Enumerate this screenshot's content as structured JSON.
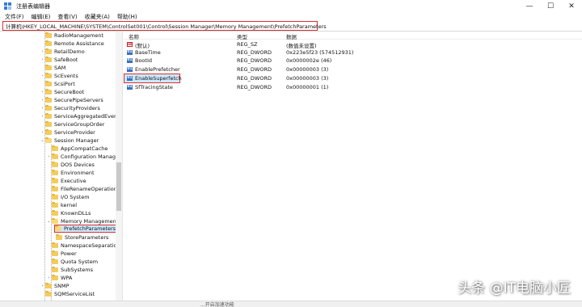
{
  "window": {
    "title": "注册表编辑器",
    "controls": [
      "—",
      "☐",
      "✕"
    ]
  },
  "menu": [
    "文件(F)",
    "编辑(E)",
    "查看(V)",
    "收藏夹(A)",
    "帮助(H)"
  ],
  "address": "计算机\\HKEY_LOCAL_MACHINE\\SYSTEM\\ControlSet001\\Control\\Session Manager\\Memory Management\\PrefetchParameters",
  "tree": [
    {
      "label": "RadioManagement",
      "level": 1,
      "expander": ""
    },
    {
      "label": "Remote Assistance",
      "level": 1,
      "expander": ""
    },
    {
      "label": "RetailDemo",
      "level": 1,
      "expander": "›"
    },
    {
      "label": "SafeBoot",
      "level": 1,
      "expander": "›"
    },
    {
      "label": "SAM",
      "level": 1,
      "expander": ""
    },
    {
      "label": "ScEvents",
      "level": 1,
      "expander": "›"
    },
    {
      "label": "ScsiPort",
      "level": 1,
      "expander": ""
    },
    {
      "label": "SecureBoot",
      "level": 1,
      "expander": "›"
    },
    {
      "label": "SecurePipeServers",
      "level": 1,
      "expander": "›"
    },
    {
      "label": "SecurityProviders",
      "level": 1,
      "expander": "›"
    },
    {
      "label": "ServiceAggregatedEvents",
      "level": 1,
      "expander": "›"
    },
    {
      "label": "ServiceGroupOrder",
      "level": 1,
      "expander": ""
    },
    {
      "label": "ServiceProvider",
      "level": 1,
      "expander": "›"
    },
    {
      "label": "Session Manager",
      "level": 1,
      "expander": "⌄"
    },
    {
      "label": "AppCompatCache",
      "level": 2,
      "expander": ""
    },
    {
      "label": "Configuration Manager",
      "level": 2,
      "expander": "›"
    },
    {
      "label": "DOS Devices",
      "level": 2,
      "expander": ""
    },
    {
      "label": "Environment",
      "level": 2,
      "expander": ""
    },
    {
      "label": "Executive",
      "level": 2,
      "expander": ""
    },
    {
      "label": "FileRenameOperations",
      "level": 2,
      "expander": ""
    },
    {
      "label": "I/O System",
      "level": 2,
      "expander": ""
    },
    {
      "label": "kernel",
      "level": 2,
      "expander": ""
    },
    {
      "label": "KnownDLLs",
      "level": 2,
      "expander": ""
    },
    {
      "label": "Memory Management",
      "level": 2,
      "expander": "⌄"
    },
    {
      "label": "PrefetchParameters",
      "level": 3,
      "expander": "",
      "selected": true
    },
    {
      "label": "StoreParameters",
      "level": 3,
      "expander": ""
    },
    {
      "label": "NamespaceSeparation",
      "level": 2,
      "expander": ""
    },
    {
      "label": "Power",
      "level": 2,
      "expander": ""
    },
    {
      "label": "Quota System",
      "level": 2,
      "expander": ""
    },
    {
      "label": "SubSystems",
      "level": 2,
      "expander": ""
    },
    {
      "label": "WPA",
      "level": 2,
      "expander": "›"
    },
    {
      "label": "SNMP",
      "level": 1,
      "expander": "›"
    },
    {
      "label": "SQMServiceList",
      "level": 1,
      "expander": ""
    }
  ],
  "list": {
    "headers": {
      "name": "名称",
      "type": "类型",
      "data": "数据"
    },
    "rows": [
      {
        "icon": "string-value-icon",
        "name": "(默认)",
        "type": "REG_SZ",
        "data": "(数值未设置)"
      },
      {
        "icon": "dword-value-icon",
        "name": "BaseTime",
        "type": "REG_DWORD",
        "data": "0x223e5f23 (574512931)"
      },
      {
        "icon": "dword-value-icon",
        "name": "BootId",
        "type": "REG_DWORD",
        "data": "0x0000002e (46)"
      },
      {
        "icon": "dword-value-icon",
        "name": "EnablePrefetcher",
        "type": "REG_DWORD",
        "data": "0x00000003 (3)"
      },
      {
        "icon": "dword-value-icon",
        "name": "EnableSuperfetch",
        "type": "REG_DWORD",
        "data": "0x00000003 (3)",
        "selected": true
      },
      {
        "icon": "dword-value-icon",
        "name": "SfTracingState",
        "type": "REG_DWORD",
        "data": "0x00000001 (1)"
      }
    ]
  },
  "watermark": "头条 @IT电脑小匠",
  "status": "...开启加速功能"
}
